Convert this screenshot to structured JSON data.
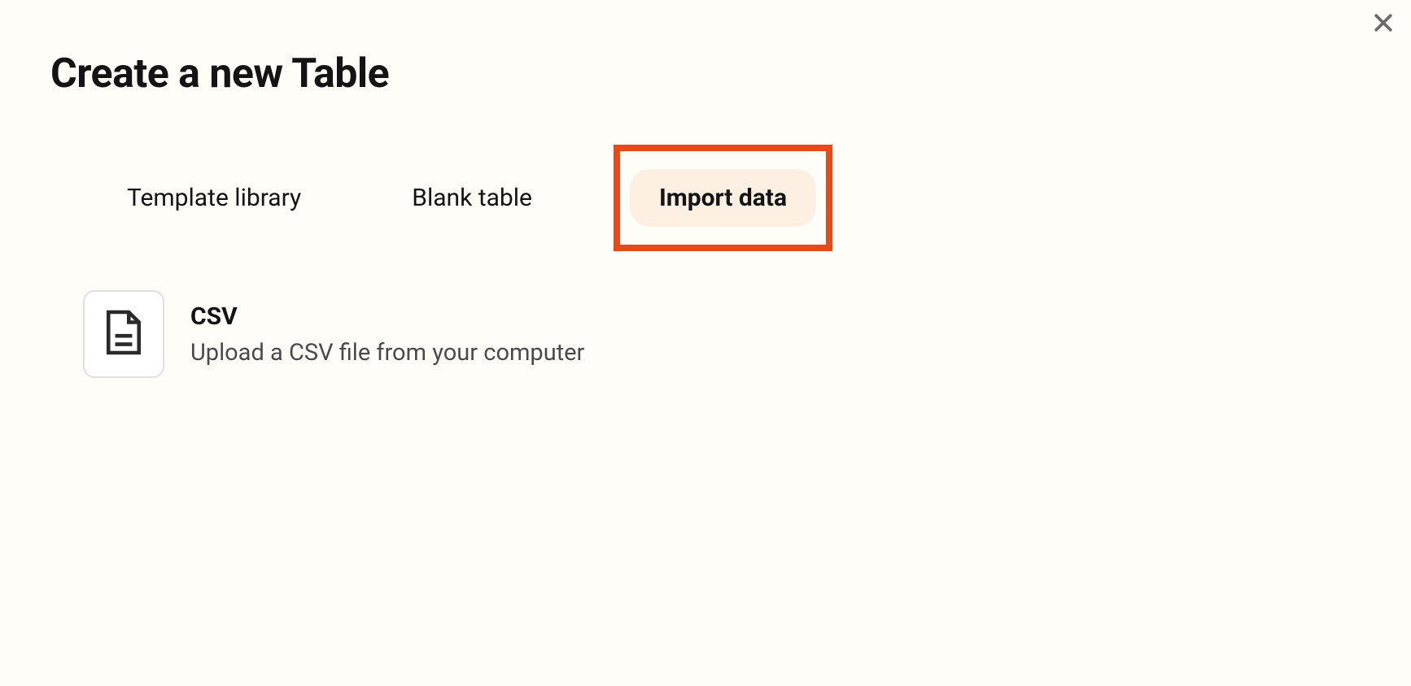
{
  "dialog": {
    "title": "Create a new Table"
  },
  "tabs": {
    "template_library": "Template library",
    "blank_table": "Blank table",
    "import_data": "Import data"
  },
  "options": {
    "csv": {
      "title": "CSV",
      "description": "Upload a CSV file from your computer"
    }
  }
}
